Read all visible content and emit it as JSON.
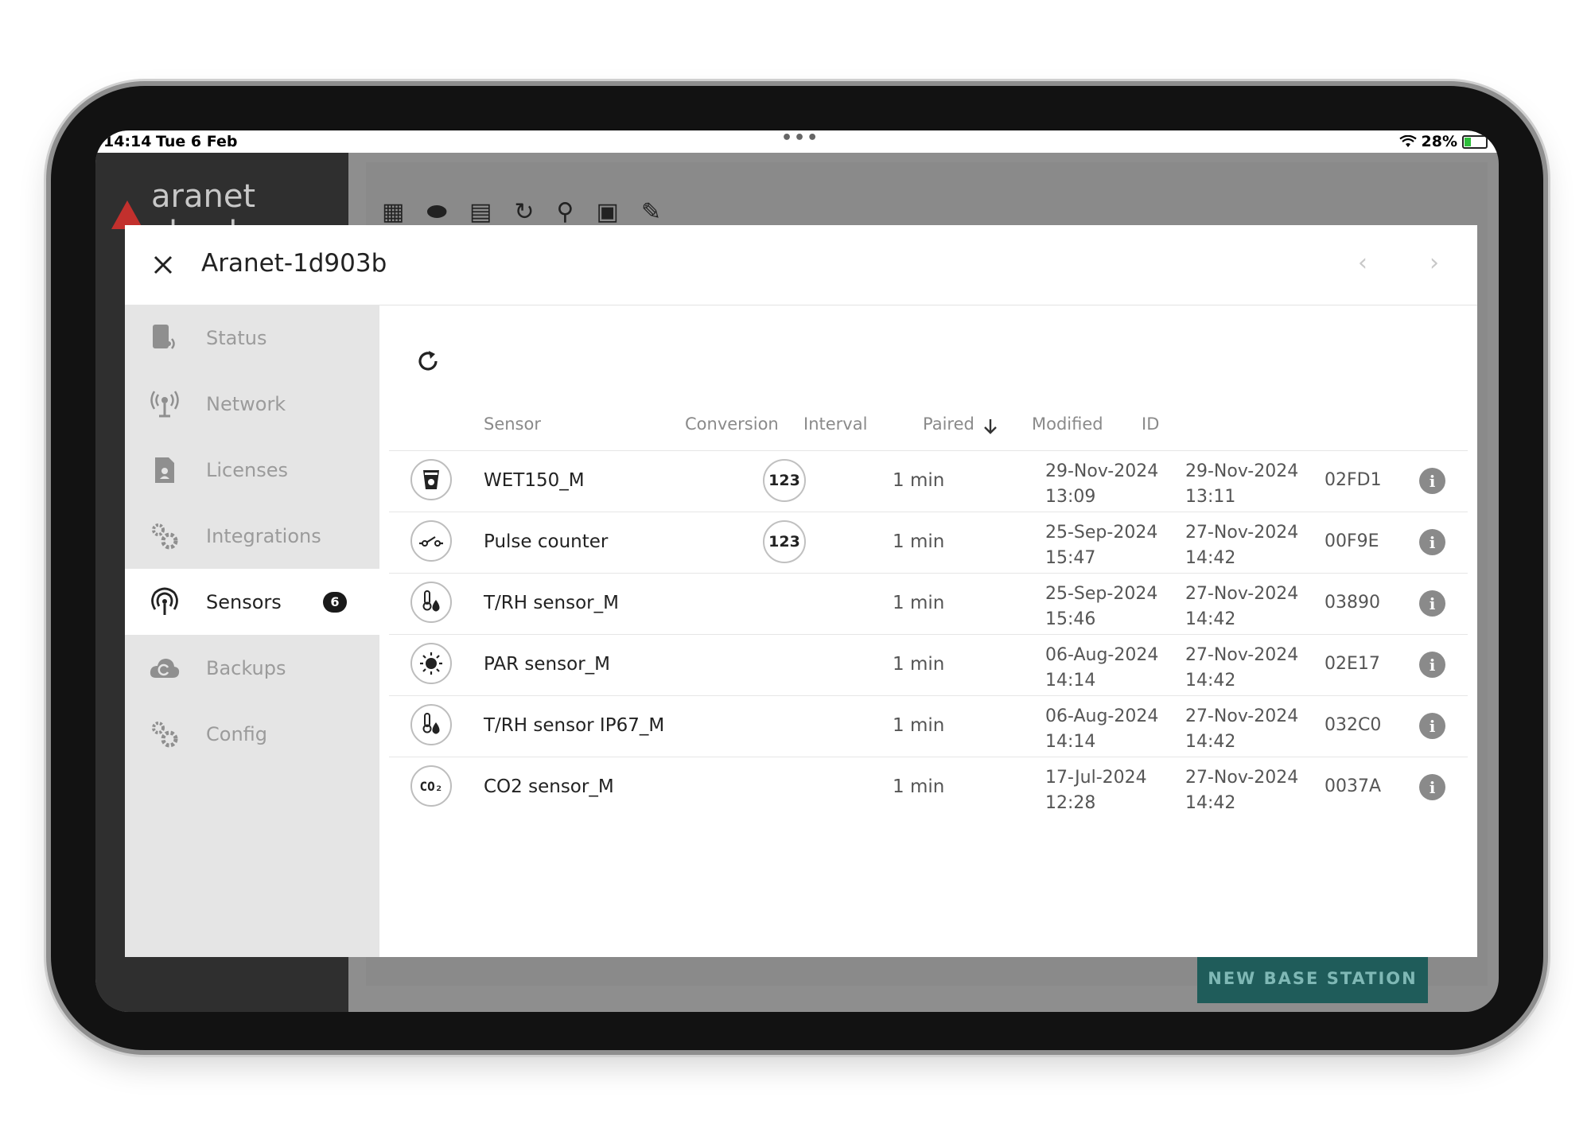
{
  "status_bar": {
    "time": "14:14",
    "date": "Tue 6 Feb",
    "battery": "28%",
    "battery_level": 0.28
  },
  "app": {
    "logo_text": "aranet cloud",
    "new_base_station_label": "NEW BASE STATION",
    "accent_color": "#1f5c5a",
    "brand_color": "#c2302d"
  },
  "modal": {
    "title": "Aranet-1d903b",
    "sidebar": [
      {
        "label": "Status",
        "icon": "status-icon"
      },
      {
        "label": "Network",
        "icon": "network-icon"
      },
      {
        "label": "Licenses",
        "icon": "license-icon"
      },
      {
        "label": "Integrations",
        "icon": "integrations-icon"
      },
      {
        "label": "Sensors",
        "icon": "sensors-icon",
        "badge": "6",
        "active": true
      },
      {
        "label": "Backups",
        "icon": "cloud-backup-icon"
      },
      {
        "label": "Config",
        "icon": "config-icon"
      }
    ],
    "table": {
      "headers": {
        "sensor": "Sensor",
        "conversion": "Conversion",
        "interval": "Interval",
        "paired": "Paired",
        "modified": "Modified",
        "id": "ID"
      },
      "sort": {
        "column": "Paired",
        "direction": "descending"
      },
      "rows": [
        {
          "icon": "wet150-icon",
          "name": "WET150_M",
          "conversion": "123",
          "interval": "1 min",
          "paired_date": "29-Nov-2024",
          "paired_time": "13:09",
          "modified_date": "29-Nov-2024",
          "modified_time": "13:11",
          "id": "02FD1"
        },
        {
          "icon": "pulse-counter-icon",
          "name": "Pulse counter",
          "conversion": "123",
          "interval": "1 min",
          "paired_date": "25-Sep-2024",
          "paired_time": "15:47",
          "modified_date": "27-Nov-2024",
          "modified_time": "14:42",
          "id": "00F9E"
        },
        {
          "icon": "temp-humidity-icon",
          "name": "T/RH sensor_M",
          "conversion": "",
          "interval": "1 min",
          "paired_date": "25-Sep-2024",
          "paired_time": "15:46",
          "modified_date": "27-Nov-2024",
          "modified_time": "14:42",
          "id": "03890"
        },
        {
          "icon": "sun-par-icon",
          "name": "PAR sensor_M",
          "conversion": "",
          "interval": "1 min",
          "paired_date": "06-Aug-2024",
          "paired_time": "14:14",
          "modified_date": "27-Nov-2024",
          "modified_time": "14:42",
          "id": "02E17"
        },
        {
          "icon": "temp-humidity-icon",
          "name": "T/RH sensor IP67_M",
          "conversion": "",
          "interval": "1 min",
          "paired_date": "06-Aug-2024",
          "paired_time": "14:14",
          "modified_date": "27-Nov-2024",
          "modified_time": "14:42",
          "id": "032C0"
        },
        {
          "icon": "co2-icon",
          "name": "CO2 sensor_M",
          "conversion": "",
          "interval": "1 min",
          "paired_date": "17-Jul-2024",
          "paired_time": "12:28",
          "modified_date": "27-Nov-2024",
          "modified_time": "14:42",
          "id": "0037A",
          "icon_text": "CO₂"
        }
      ]
    }
  }
}
